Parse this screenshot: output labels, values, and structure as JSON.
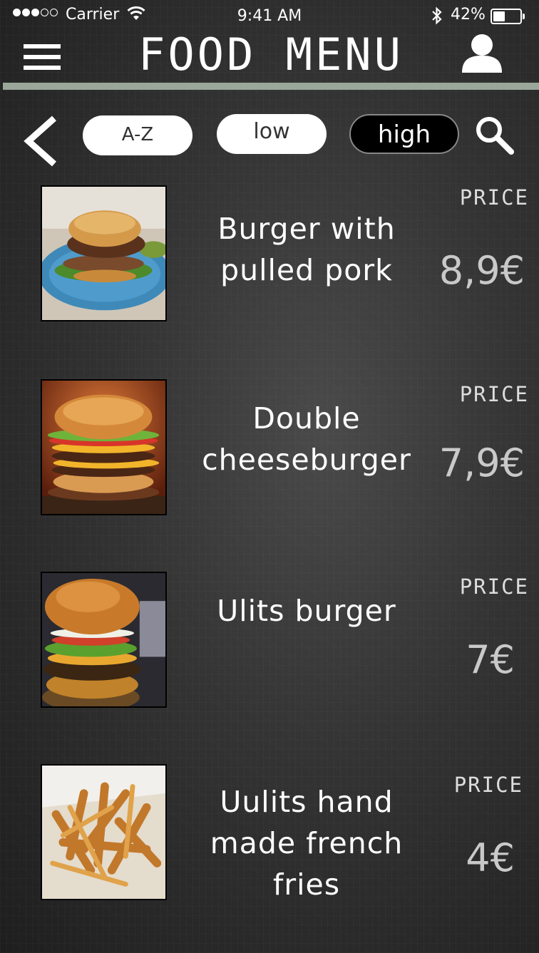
{
  "status_bar": {
    "carrier": "Carrier",
    "time": "9:41 AM",
    "battery": "42%"
  },
  "header": {
    "title": "FOOD MENU",
    "menu_icon": "hamburger-menu-icon",
    "profile_icon": "user-icon"
  },
  "filters": {
    "back_icon": "chevron-left-icon",
    "sort_az": "A-Z",
    "sort_low": "low",
    "sort_high": "high",
    "search_icon": "search-icon"
  },
  "items": [
    {
      "name_line1": "Burger with",
      "name_line2": "pulled pork",
      "name_line3": "",
      "price_label": "PRICE",
      "price": "8,9€"
    },
    {
      "name_line1": "Double",
      "name_line2": "cheeseburger",
      "name_line3": "",
      "price_label": "PRICE",
      "price": "7,9€"
    },
    {
      "name_line1": "Ulits burger",
      "name_line2": "",
      "name_line3": "",
      "price_label": "PRICE",
      "price": "7€"
    },
    {
      "name_line1": "Uulits hand",
      "name_line2": "made french",
      "name_line3": "fries",
      "price_label": "PRICE",
      "price": "4€"
    }
  ],
  "colors": {
    "accent_bar": "#9aa79a",
    "price_text": "#c9c9c9"
  }
}
